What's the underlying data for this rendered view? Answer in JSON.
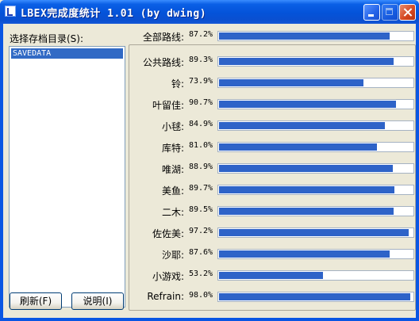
{
  "window": {
    "title": "LBEX完成度统计 1.01 (by dwing)"
  },
  "sidebar": {
    "label": "选择存档目录(S):",
    "items": [
      "SAVEDATA"
    ],
    "selected_index": 0
  },
  "buttons": {
    "refresh": "刷新(F)",
    "help": "说明(I)"
  },
  "stats": [
    {
      "label": "全部路线:",
      "percent": "87.2%",
      "value": 87.2
    },
    {
      "label": "公共路线:",
      "percent": "89.3%",
      "value": 89.3
    },
    {
      "label": "铃:",
      "percent": "73.9%",
      "value": 73.9
    },
    {
      "label": "叶留佳:",
      "percent": "90.7%",
      "value": 90.7
    },
    {
      "label": "小毬:",
      "percent": "84.9%",
      "value": 84.9
    },
    {
      "label": "库特:",
      "percent": "81.0%",
      "value": 81.0
    },
    {
      "label": "唯湖:",
      "percent": "88.9%",
      "value": 88.9
    },
    {
      "label": "美鱼:",
      "percent": "89.7%",
      "value": 89.7
    },
    {
      "label": "二木:",
      "percent": "89.5%",
      "value": 89.5
    },
    {
      "label": "佐佐美:",
      "percent": "97.2%",
      "value": 97.2
    },
    {
      "label": "沙耶:",
      "percent": "87.6%",
      "value": 87.6
    },
    {
      "label": "小游戏:",
      "percent": "53.2%",
      "value": 53.2
    },
    {
      "label": "Refrain:",
      "percent": "98.0%",
      "value": 98.0
    }
  ],
  "colors": {
    "bar_fill": "#2E63C8",
    "selection": "#316AC5",
    "title_bar": "#0A5FE6"
  }
}
